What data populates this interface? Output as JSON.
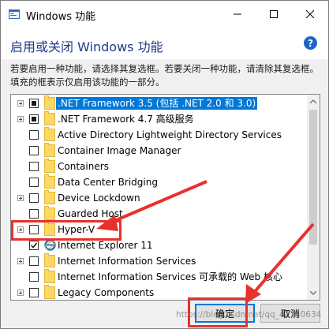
{
  "window": {
    "title": "Windows 功能",
    "heading": "启用或关闭 Windows 功能",
    "help": "?",
    "description": "若要启用一种功能，请选择其复选框。若要关闭一种功能，请清除其复选框。填充的框表示仅启用该功能的一部分。"
  },
  "features": [
    {
      "label": ".NET Framework 3.5 (包括 .NET 2.0 和 3.0)",
      "state": "partial",
      "expandable": true,
      "icon": "folder-icon",
      "selected": true
    },
    {
      "label": ".NET Framework 4.7 高级服务",
      "state": "partial",
      "expandable": true,
      "icon": "folder-icon"
    },
    {
      "label": "Active Directory Lightweight Directory Services",
      "state": "unchecked",
      "expandable": false,
      "icon": "folder-icon"
    },
    {
      "label": "Container Image Manager",
      "state": "unchecked",
      "expandable": false,
      "icon": "folder-icon"
    },
    {
      "label": "Containers",
      "state": "unchecked",
      "expandable": false,
      "icon": "folder-icon"
    },
    {
      "label": "Data Center Bridging",
      "state": "unchecked",
      "expandable": false,
      "icon": "folder-icon"
    },
    {
      "label": "Device Lockdown",
      "state": "unchecked",
      "expandable": true,
      "icon": "folder-icon"
    },
    {
      "label": "Guarded Host",
      "state": "unchecked",
      "expandable": false,
      "icon": "folder-icon"
    },
    {
      "label": "Hyper-V",
      "state": "unchecked",
      "expandable": true,
      "icon": "folder-icon"
    },
    {
      "label": "Internet Explorer 11",
      "state": "checked",
      "expandable": false,
      "icon": "ie-icon"
    },
    {
      "label": "Internet Information Services",
      "state": "unchecked",
      "expandable": true,
      "icon": "folder-icon"
    },
    {
      "label": "Internet Information Services 可承载的 Web 核心",
      "state": "unchecked",
      "expandable": false,
      "icon": "folder-icon"
    },
    {
      "label": "Legacy Components",
      "state": "unchecked",
      "expandable": true,
      "icon": "folder-icon"
    }
  ],
  "buttons": {
    "ok": "确定",
    "cancel": "取消"
  },
  "watermark": "https://blog.csdn.net/qq_41740634",
  "colors": {
    "selection": "#0078d7",
    "annotation_red": "#e8302c",
    "heading": "#1e3b8a"
  }
}
